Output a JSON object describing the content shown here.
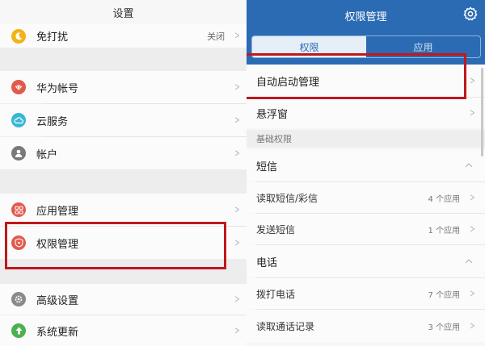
{
  "left": {
    "title": "设置",
    "items": [
      {
        "label": "免打扰",
        "value": "关闭",
        "icon": "moon-icon",
        "icon_color": "#f2b318"
      },
      {
        "label": "华为帐号",
        "icon": "huawei-logo-icon",
        "icon_color": "#e25a4c"
      },
      {
        "label": "云服务",
        "icon": "cloud-icon",
        "icon_color": "#38b6d6"
      },
      {
        "label": "帐户",
        "icon": "user-icon",
        "icon_color": "#7a7a7a"
      },
      {
        "label": "应用管理",
        "icon": "app-grid-icon",
        "icon_color": "#e25a4c"
      },
      {
        "label": "权限管理",
        "icon": "shield-icon",
        "icon_color": "#e25a4c"
      },
      {
        "label": "高级设置",
        "icon": "gear-icon",
        "icon_color": "#8a8a8a"
      },
      {
        "label": "系统更新",
        "icon": "update-arrow-icon",
        "icon_color": "#4cb050"
      }
    ]
  },
  "right": {
    "title": "权限管理",
    "tabs": [
      "权限",
      "应用"
    ],
    "active_tab": "权限",
    "items": [
      {
        "label": "自动启动管理"
      },
      {
        "label": "悬浮窗"
      }
    ],
    "section_basic": "基础权限",
    "groups": [
      {
        "label": "短信",
        "items": [
          {
            "label": "读取短信/彩信",
            "count": "4 个应用"
          },
          {
            "label": "发送短信",
            "count": "1 个应用"
          }
        ]
      },
      {
        "label": "电话",
        "items": [
          {
            "label": "拨打电话",
            "count": "7 个应用"
          },
          {
            "label": "读取通话记录",
            "count": "3 个应用"
          }
        ]
      }
    ]
  },
  "colors": {
    "header_blue": "#2b6bb4",
    "highlight_red": "#c0181c"
  }
}
